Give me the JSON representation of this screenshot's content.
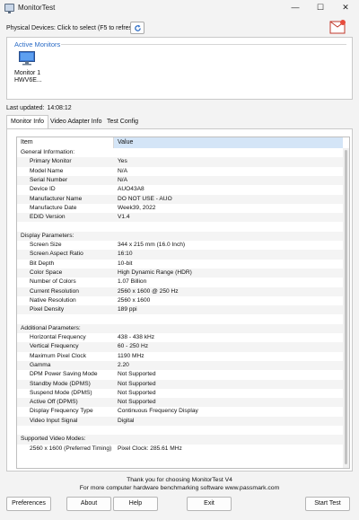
{
  "window": {
    "title": "MonitorTest",
    "minimize": "—",
    "maximize": "☐",
    "close": "✕"
  },
  "physical_devices_label": "Physical Devices: Click to select (F5 to refresh)",
  "active_monitors": {
    "title": "Active Monitors",
    "monitor_line1": "Monitor 1",
    "monitor_line2": "HWV6E..."
  },
  "last_updated": {
    "label": "Last updated:",
    "value": "14:08:12"
  },
  "tabs": [
    "Monitor Info",
    "Video Adapter Info",
    "Test Config"
  ],
  "table": {
    "headers": [
      "Item",
      "Value"
    ],
    "rows": [
      {
        "item": "General Information:",
        "value": "",
        "section": true
      },
      {
        "item": "Primary Monitor",
        "value": "Yes"
      },
      {
        "item": "Model Name",
        "value": "N/A"
      },
      {
        "item": "Serial Number",
        "value": "N/A"
      },
      {
        "item": "Device ID",
        "value": "AUO43A8"
      },
      {
        "item": "Manufacturer Name",
        "value": "DO NOT USE - AUO"
      },
      {
        "item": "Manufacture Date",
        "value": "Week39, 2022"
      },
      {
        "item": "EDID Version",
        "value": "V1.4"
      },
      {
        "item": "",
        "value": ""
      },
      {
        "item": "Display Parameters:",
        "value": "",
        "section": true
      },
      {
        "item": "Screen Size",
        "value": "344 x 215 mm (16.0 Inch)"
      },
      {
        "item": "Screen Aspect Ratio",
        "value": "16:10"
      },
      {
        "item": "Bit Depth",
        "value": "10-bit"
      },
      {
        "item": "Color Space",
        "value": "High Dynamic Range (HDR)"
      },
      {
        "item": "Number of Colors",
        "value": "1.07 Billion"
      },
      {
        "item": "Current Resolution",
        "value": "2560 x 1600 @ 250 Hz"
      },
      {
        "item": "Native Resolution",
        "value": "2560 x 1600"
      },
      {
        "item": "Pixel Density",
        "value": "189 ppi"
      },
      {
        "item": "",
        "value": ""
      },
      {
        "item": "Additional Parameters:",
        "value": "",
        "section": true
      },
      {
        "item": "Horizontal Frequency",
        "value": "438 - 438 kHz"
      },
      {
        "item": "Vertical Frequency",
        "value": "60 - 250 Hz"
      },
      {
        "item": "Maximum Pixel Clock",
        "value": "1190 MHz"
      },
      {
        "item": "Gamma",
        "value": "2.20"
      },
      {
        "item": "DPM Power Saving Mode",
        "value": "Not Supported"
      },
      {
        "item": "Standby Mode (DPMS)",
        "value": "Not Supported"
      },
      {
        "item": "Suspend Mode (DPMS)",
        "value": "Not Supported"
      },
      {
        "item": "Active Off (DPMS)",
        "value": "Not Supported"
      },
      {
        "item": "Display Frequency Type",
        "value": "Continuous Frequency Display"
      },
      {
        "item": "Video Input Signal",
        "value": "Digital"
      },
      {
        "item": "",
        "value": ""
      },
      {
        "item": "Supported Video Modes:",
        "value": "",
        "section": true
      },
      {
        "item": "2560 x 1600 (Preferred Timing)",
        "value": "Pixel Clock: 285.61 MHz"
      }
    ]
  },
  "footer": {
    "line1": "Thank you for choosing MonitorTest V4",
    "line2": "For more computer hardware benchmarking software www.passmark.com"
  },
  "buttons": {
    "preferences": "Preferences",
    "about": "About",
    "help": "Help",
    "exit": "Exit",
    "start_test": "Start Test"
  },
  "colors": {
    "accent": "#2a6bc5",
    "header_selected": "#d4e5f7"
  },
  "icons": {
    "app": "monitor-icon",
    "refresh": "refresh-icon",
    "logo": "passmark-logo"
  }
}
